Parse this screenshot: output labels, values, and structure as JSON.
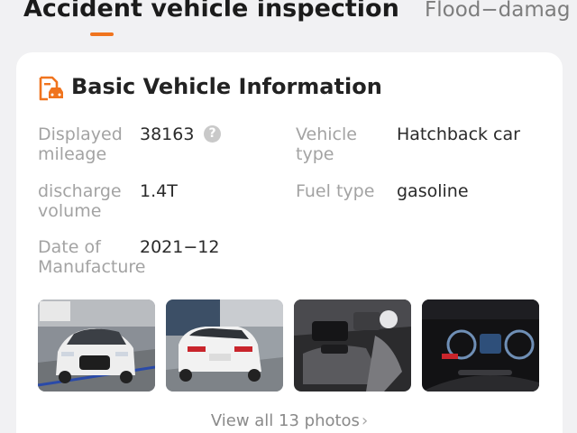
{
  "tabs": [
    {
      "label": "Accident vehicle inspection",
      "active": true
    },
    {
      "label": "Flood−damag",
      "active": false
    }
  ],
  "colors": {
    "accent": "#f0741e",
    "label": "#a3a3a3",
    "value": "#2a2a2a"
  },
  "card": {
    "title": "Basic Vehicle Information",
    "icon": "vehicle-document-icon",
    "fields": {
      "mileage": {
        "label": "Displayed mileage",
        "value": "38163",
        "icon": "help-icon"
      },
      "vehicle_type": {
        "label": "Vehicle type",
        "value": "Hatchback car"
      },
      "displacement": {
        "label": "discharge volume",
        "value": "1.4T"
      },
      "fuel_type": {
        "label": "Fuel type",
        "value": "gasoline"
      },
      "manufacture_date": {
        "label": "Date of Manufacture",
        "value": "2021−12"
      }
    },
    "photos": [
      {
        "name": "front-exterior-photo"
      },
      {
        "name": "rear-exterior-photo"
      },
      {
        "name": "interior-console-photo"
      },
      {
        "name": "instrument-cluster-photo"
      }
    ],
    "view_all": "View all 13 photos"
  }
}
